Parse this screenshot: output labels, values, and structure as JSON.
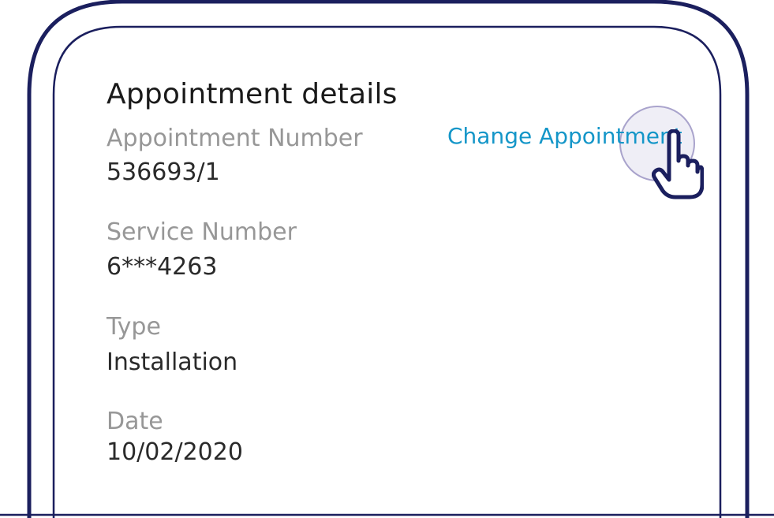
{
  "card": {
    "title": "Appointment details",
    "change_link": "Change Appointment",
    "fields": [
      {
        "label": "Appointment Number",
        "value": "536693/1"
      },
      {
        "label": "Service Number",
        "value": "6***4263"
      },
      {
        "label": "Type",
        "value": "Installation"
      },
      {
        "label": "Date",
        "value": "10/02/2020"
      }
    ]
  },
  "colors": {
    "frame": "#1b1f5e",
    "title": "#1a1a1a",
    "label": "#979797",
    "value": "#2a2a2a",
    "link": "#1496c8"
  },
  "icons": {
    "cursor": "hand-pointer-icon"
  }
}
